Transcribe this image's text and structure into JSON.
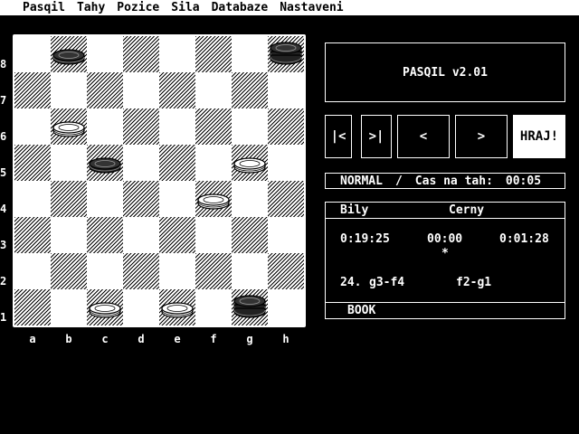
{
  "menu": [
    "Pasqil",
    "Tahy",
    "Pozice",
    "Sila",
    "Databaze",
    "Nastaveni"
  ],
  "board": {
    "ranks": [
      "8",
      "7",
      "6",
      "5",
      "4",
      "3",
      "2",
      "1"
    ],
    "files": [
      "a",
      "b",
      "c",
      "d",
      "e",
      "f",
      "g",
      "h"
    ],
    "pieces": [
      {
        "square": "b8",
        "color": "black",
        "type": "man"
      },
      {
        "square": "h8",
        "color": "black",
        "type": "king"
      },
      {
        "square": "b6",
        "color": "white",
        "type": "man"
      },
      {
        "square": "c5",
        "color": "black",
        "type": "man"
      },
      {
        "square": "g5",
        "color": "white",
        "type": "man"
      },
      {
        "square": "f4",
        "color": "white",
        "type": "man"
      },
      {
        "square": "c1",
        "color": "white",
        "type": "man"
      },
      {
        "square": "e1",
        "color": "white",
        "type": "man"
      },
      {
        "square": "g1",
        "color": "black",
        "type": "king"
      }
    ]
  },
  "title": "PASQIL v2.01",
  "controls": {
    "first": "|<",
    "last": ">|",
    "prev": "<",
    "next": ">",
    "play": "HRAJ!"
  },
  "mode": {
    "level": "NORMAL",
    "separator": "/",
    "time_label": "Cas na tah:",
    "time_value": "00:05"
  },
  "info": {
    "white_label": "Bily",
    "black_label": "Cerny",
    "white_time": "0:19:25",
    "current_time": "00:00",
    "black_time": "0:01:28",
    "turn_marker": "*",
    "move_number": "24.",
    "white_move": "g3-f4",
    "black_move": "f2-g1",
    "status": "BOOK"
  }
}
